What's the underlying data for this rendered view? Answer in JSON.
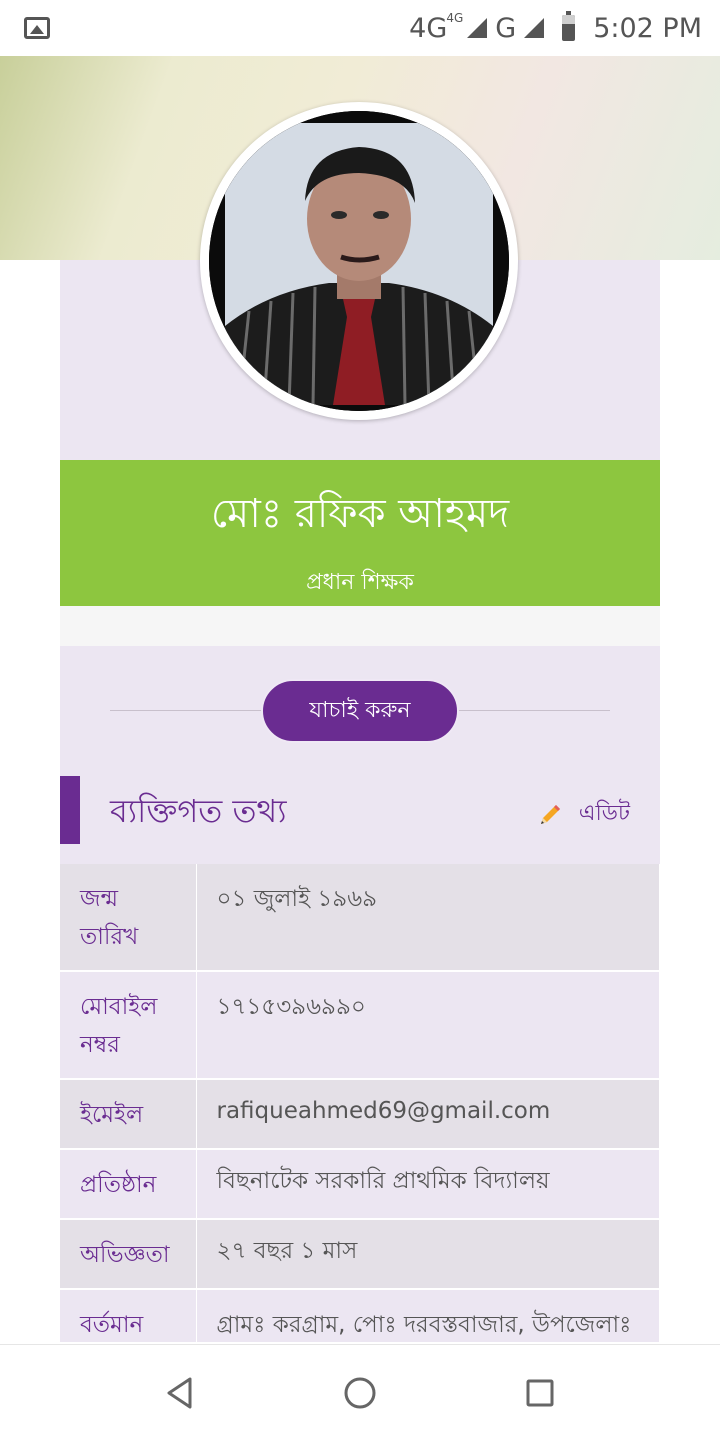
{
  "status_bar": {
    "network_primary": "4G",
    "network_primary_sup": "4G",
    "network_secondary": "G",
    "time": "5:02 PM",
    "notification_icon": "image-icon"
  },
  "profile": {
    "name": "মোঃ রফিক আহমদ",
    "designation": "প্রধান শিক্ষক"
  },
  "verify_button_label": "যাচাই করুন",
  "section": {
    "title": "ব্যক্তিগত তথ্য",
    "edit_label": "এডিট"
  },
  "info_rows": [
    {
      "label": "জন্ম তারিখ",
      "value": "০১ জুলাই ১৯৬৯"
    },
    {
      "label": "মোবাইল নম্বর",
      "value": "১৭১৫৩৯৬৯৯০"
    },
    {
      "label": "ইমেইল",
      "value": "rafiqueahmed69@gmail.com"
    },
    {
      "label": "প্রতিষ্ঠান",
      "value": "বিছনাটেক সরকারি প্রাথমিক বিদ্যালয়"
    },
    {
      "label": "অভিজ্ঞতা",
      "value": "২৭ বছর ১ মাস"
    },
    {
      "label": "বর্তমান ঠিকানা",
      "value": "গ্রামঃ করগ্রাম, পোঃ দরবস্তবাজার, উপজেলাঃ জৈন্তাপুর, জেলাঃ সিলেট"
    }
  ],
  "colors": {
    "accent_purple": "#6a2c91",
    "name_banner_green": "#8dc63f",
    "card_lavender": "#ece6f2"
  }
}
